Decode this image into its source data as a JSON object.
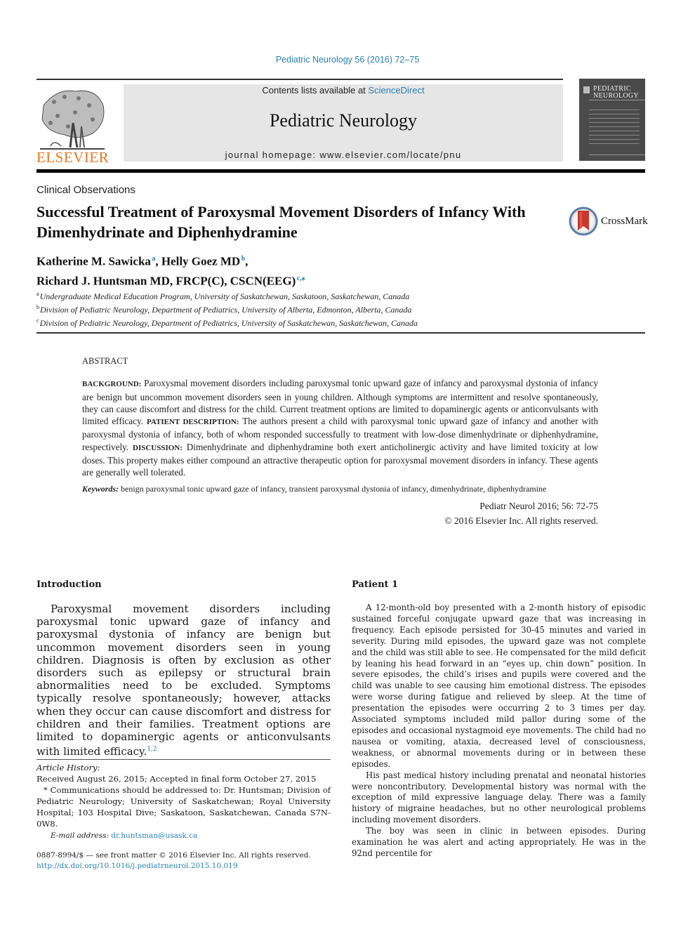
{
  "header": {
    "citation": "Pediatric Neurology 56 (2016) 72–75",
    "contents_prefix": "Contents lists available at ",
    "contents_link": "ScienceDirect",
    "journal_name": "Pediatric Neurology",
    "homepage": "journal homepage: www.elsevier.com/locate/pnu",
    "publisher_logo_text": "ELSEVIER",
    "cover_title_line1": "PEDIATRIC",
    "cover_title_line2": "NEUROLOGY",
    "publisher_color": "#e87722",
    "link_color": "#2a7fb0"
  },
  "article": {
    "section": "Clinical Observations",
    "title": "Successful Treatment of Paroxysmal Movement Disorders of Infancy With Dimenhydrinate and Diphenhydramine",
    "crossmark_label": "CrossMark",
    "authors": [
      {
        "name": "Katherine M. Sawicka",
        "sup": "a",
        "sep": ", "
      },
      {
        "name": "Helly Goez MD",
        "sup": "b",
        "sep": ","
      },
      {
        "name": "Richard J. Huntsman MD, FRCP(C), CSCN(EEG)",
        "sup": "c,⁎",
        "sep": ""
      }
    ],
    "affiliations": [
      {
        "key": "a",
        "text": "Undergraduate Medical Education Program, University of Saskatchewan, Saskatoon, Saskatchewan, Canada"
      },
      {
        "key": "b",
        "text": "Division of Pediatric Neurology, Department of Pediatrics, University of Alberta, Edmonton, Alberta, Canada"
      },
      {
        "key": "c",
        "text": "Division of Pediatric Neurology, Department of Pediatrics, University of Saskatchewan, Saskatchewan, Canada"
      }
    ]
  },
  "abstract": {
    "heading": "ABSTRACT",
    "background_label": "BACKGROUND:",
    "background": " Paroxysmal movement disorders including paroxysmal tonic upward gaze of infancy and paroxysmal dystonia of infancy are benign but uncommon movement disorders seen in young children. Although symptoms are intermittent and resolve spontaneously, they can cause discomfort and distress for the child. Current treatment options are limited to dopaminergic agents or anticonvulsants with limited efficacy. ",
    "patient_label": "PATIENT DESCRIPTION:",
    "patient": " The authors present a child with paroxysmal tonic upward gaze of infancy and another with paroxysmal dystonia of infancy, both of whom responded successfully to treatment with low-dose dimenhydrinate or diphenhydramine, respectively. ",
    "discussion_label": "DISCUSSION:",
    "discussion": " Dimenhydrinate and diphenhydramine both exert anticholinergic activity and have limited toxicity at low doses. This property makes either compound an attractive therapeutic option for paroxysmal movement disorders in infancy. These agents are generally well tolerated.",
    "keywords_label": "Keywords:",
    "keywords": " benign paroxysmal tonic upward gaze of infancy, transient paroxysmal dystonia of infancy, dimenhydrinate, diphenhydramine",
    "journal_cite": "Pediatr Neurol 2016; 56: 72-75",
    "copyright": "© 2016 Elsevier Inc. All rights reserved."
  },
  "introduction": {
    "heading": "Introduction",
    "body": "Paroxysmal movement disorders including paroxysmal tonic upward gaze of infancy and paroxysmal dystonia of infancy are benign but uncommon movement disorders seen in young children. Diagnosis is often by exclusion as other disorders such as epilepsy or structural brain abnormalities need to be excluded. Symptoms typically resolve spontaneously; however, attacks when they occur can cause discomfort and distress for children and their families. Treatment options are limited to dopaminergic agents or anticonvulsants with limited efficacy.",
    "refs": "1,2"
  },
  "patient1": {
    "heading": "Patient 1",
    "paragraphs": [
      "A 12-month-old boy presented with a 2-month history of episodic sustained forceful conjugate upward gaze that was increasing in frequency. Each episode persisted for 30-45 minutes and varied in severity. During mild episodes, the upward gaze was not complete and the child was still able to see. He compensated for the mild deficit by leaning his head forward in an “eyes up, chin down” position. In severe episodes, the child’s irises and pupils were covered and the child was unable to see causing him emotional distress. The episodes were worse during fatigue and relieved by sleep. At the time of presentation the episodes were occurring 2 to 3 times per day. Associated symptoms included mild pallor during some of the episodes and occasional nystagmoid eye movements. The child had no nausea or vomiting, ataxia, decreased level of consciousness, weakness, or abnormal movements during or in between these episodes.",
      "His past medical history including prenatal and neonatal histories were noncontributory. Developmental history was normal with the exception of mild expressive language delay. There was a family history of migraine headaches, but no other neurological problems including movement disorders.",
      "The boy was seen in clinic in between episodes. During examination he was alert and acting appropriately. He was in the 92nd percentile for"
    ]
  },
  "footnote": {
    "history_label": "Article History:",
    "history": "Received August 26, 2015; Accepted in final form October 27, 2015",
    "correspondence": "* Communications should be addressed to: Dr. Huntsman; Division of Pediatric Neurology; University of Saskatchewan; Royal University Hospital; 103 Hospital Dive; Saskatoon, Saskatchewan, Canada S7N-0W8.",
    "email_label": "E-mail address: ",
    "email": "dr.huntsman@usask.ca"
  },
  "front_matter": {
    "issn_line": "0887-8994/$ — see front matter © 2016 Elsevier Inc. All rights reserved.",
    "doi": "http://dx.doi.org/10.1016/j.pediatrneurol.2015.10.019"
  }
}
